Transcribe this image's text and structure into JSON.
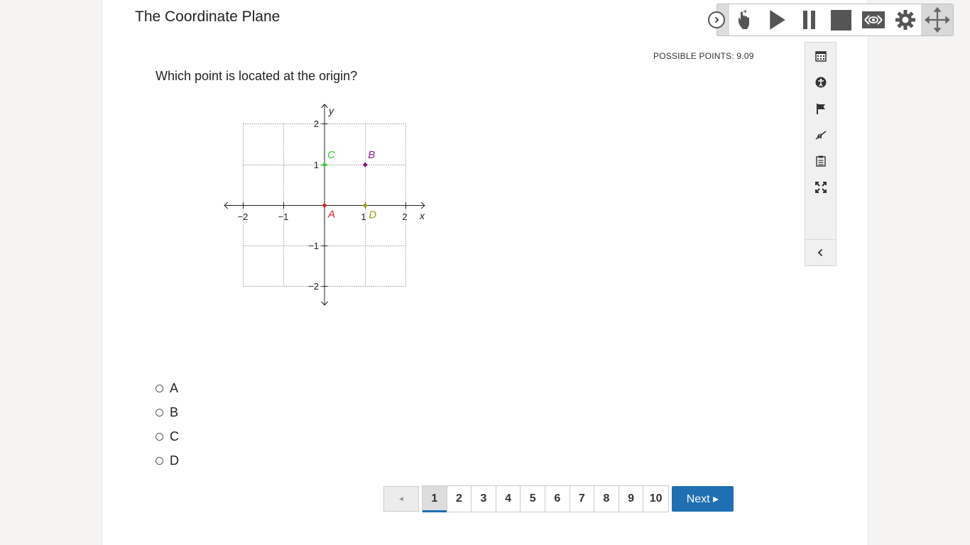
{
  "header": {
    "title": "The Coordinate Plane",
    "possible_points": "POSSIBLE POINTS: 9.09"
  },
  "question": {
    "text": "Which point is located at the origin?"
  },
  "graph": {
    "x_label": "x",
    "y_label": "y",
    "x_ticks": [
      "−2",
      "−1",
      "1",
      "2"
    ],
    "y_ticks": [
      "2",
      "1",
      "−1",
      "−2"
    ],
    "points": [
      {
        "label": "A",
        "x": 0,
        "y": 0,
        "color": "#d42020"
      },
      {
        "label": "B",
        "x": 1,
        "y": 1,
        "color": "#8b1a8b"
      },
      {
        "label": "C",
        "x": 0,
        "y": 1,
        "color": "#33cc33"
      },
      {
        "label": "D",
        "x": 1,
        "y": 0,
        "color": "#9a9a10"
      }
    ]
  },
  "choices": [
    "A",
    "B",
    "C",
    "D"
  ],
  "pagination": {
    "prev": "◄",
    "pages": [
      "1",
      "2",
      "3",
      "4",
      "5",
      "6",
      "7",
      "8",
      "9",
      "10"
    ],
    "active": "1",
    "next": "Next ▸"
  },
  "side_tools": [
    "calendar-icon",
    "accessibility-icon",
    "flag-icon",
    "strikethrough-icon",
    "notepad-icon",
    "fullscreen-icon"
  ],
  "toolbar": [
    "toggle-icon",
    "hand-pointer-icon",
    "play-icon",
    "pause-icon",
    "stop-icon",
    "mask-icon",
    "settings-icon",
    "move-icon"
  ]
}
